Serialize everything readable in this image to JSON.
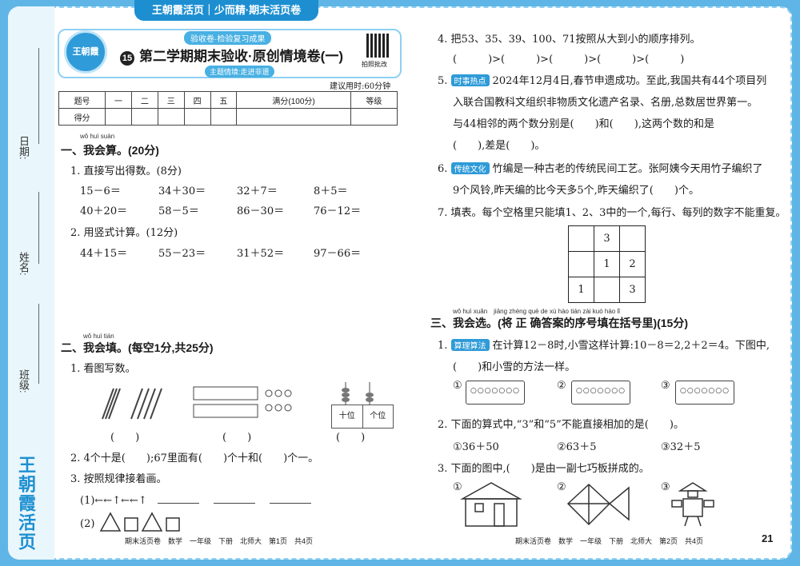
{
  "banner": "王朝霞活页｜少而精·期末活页卷",
  "brand_vertical": "王朝霞活页",
  "logo_text": "王朝霞",
  "header": {
    "pill_top": "验收卷·检验复习成果",
    "number": "15",
    "title": "第二学期期末验收·原创情境卷(一)",
    "pill_bottom": "主题情境:走进非遗",
    "qr_caption": "拍照批改",
    "time_note": "建议用时:60分钟"
  },
  "left_fields": {
    "date": "日期:",
    "name": "姓名:",
    "class": "班级:"
  },
  "score_table": {
    "headers": [
      "题号",
      "一",
      "二",
      "三",
      "四",
      "五",
      "满分(100分)",
      "等级"
    ],
    "row_label": "得分"
  },
  "section1": {
    "pinyin": "wǒ huì suàn",
    "title": "一、我会算。(20分)",
    "q1": "1. 直接写出得数。(8分)",
    "q1_items": [
      "15－6＝",
      "34＋30＝",
      "32＋7＝",
      "8＋5＝",
      "40＋20＝",
      "58－5＝",
      "86－30＝",
      "76－12＝"
    ],
    "q2": "2. 用竖式计算。(12分)",
    "q2_items": [
      "44＋15＝",
      "55－23＝",
      "31＋52＝",
      "97－66＝"
    ]
  },
  "section2": {
    "pinyin": "wǒ huì tián",
    "title": "二、我会填。(每空1分,共25分)",
    "q1": "1. 看图写数。",
    "abacus_labels": [
      "十位",
      "个位"
    ],
    "paren": "(　　)",
    "q2": "2. 4个十是(　　);67里面有(　　)个十和(　　)个一。",
    "q3": "3. 按照规律接着画。",
    "q3_1": "(1)←←↑←←↑",
    "q3_2": "(2)"
  },
  "section2_cont": {
    "q4": "4. 把53、35、39、100、71按照从大到小的顺序排列。",
    "q4_blank": "(　　　)>(　　　)>(　　　)>(　　　)>(　　　)",
    "q5_tag": "时事热点",
    "q5_l1": "2024年12月4日,春节申遗成功。至此,我国共有44个项目列",
    "q5_l2": "入联合国教科文组织非物质文化遗产名录、名册,总数居世界第一。",
    "q5_l3": "与44相邻的两个数分别是(　　)和(　　),这两个数的和是",
    "q5_l4": "(　　),差是(　　)。",
    "q6_tag": "传统文化",
    "q6_l1": "竹编是一种古老的传统民间工艺。张阿姨今天用竹子编织了",
    "q6_l2": "9个风铃,昨天编的比今天多5个,昨天编织了(　　)个。",
    "q7": "7. 填表。每个空格里只能填1、2、3中的一个,每行、每列的数字不能重复。",
    "grid": [
      [
        "",
        "3",
        ""
      ],
      [
        "",
        "1",
        "2"
      ],
      [
        "1",
        "",
        "3"
      ]
    ]
  },
  "section3": {
    "pinyin": "wǒ huì xuǎn　jiāng zhèng què de xù hào tián zài kuò hào lǐ",
    "title": "三、我会选。(将 正 确答案的序号填在括号里)(15分)",
    "q1_tag": "算理算法",
    "q1_l1": "在计算12－8时,小雪这样计算:10－8＝2,2＋2＝4。下图中,",
    "q1_l2": "(　　)和小雪的方法一样。",
    "opts": [
      "①",
      "②",
      "③"
    ],
    "q2": "2. 下面的算式中,“3”和“5”不能直接相加的是(　　)。",
    "q2_opts": [
      "①36＋50",
      "②63＋5",
      "③32＋5"
    ],
    "q3": "3. 下面的图中,(　　)是由一副七巧板拼成的。"
  },
  "footer": {
    "left": "期末活页卷　数学　一年级　下册　北师大　第1页　共4页",
    "right": "期末活页卷　数学　一年级　下册　北师大　第2页　共4页",
    "page": "21"
  }
}
